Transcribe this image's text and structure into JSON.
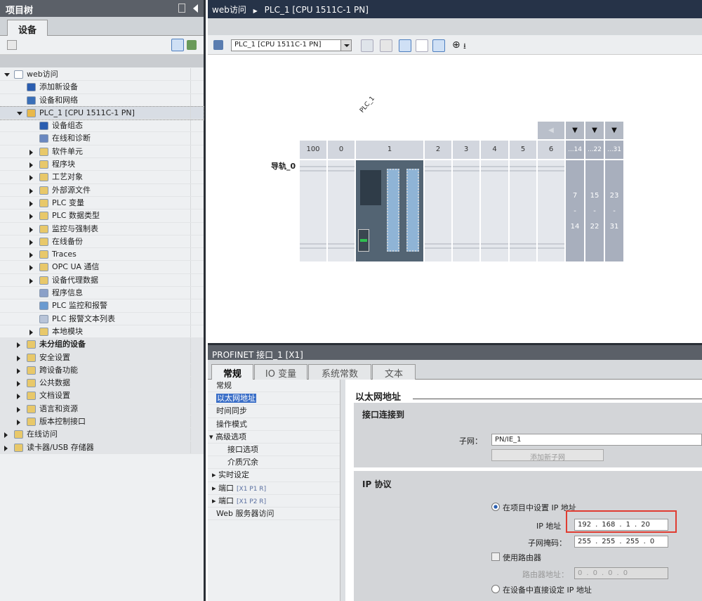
{
  "left_panel": {
    "title": "项目树",
    "tab": "设备",
    "tree": [
      {
        "label": "web访问",
        "level": 0,
        "expander": "open",
        "icon": "project-icon",
        "color": "#ffffff"
      },
      {
        "label": "添加新设备",
        "level": 1,
        "expander": "none",
        "icon": "add-device-icon",
        "color": "#2a5db0"
      },
      {
        "label": "设备和网络",
        "level": 1,
        "expander": "none",
        "icon": "network-icon",
        "color": "#3a6fb8"
      },
      {
        "label": "PLC_1 [CPU 1511C-1 PN]",
        "level": 1,
        "expander": "open",
        "icon": "plc-icon",
        "color": "#e8b84a",
        "selected": true
      },
      {
        "label": "设备组态",
        "level": 2,
        "expander": "none",
        "icon": "device-config-icon",
        "color": "#2a5db0"
      },
      {
        "label": "在线和诊断",
        "level": 2,
        "expander": "none",
        "icon": "diagnostics-icon",
        "color": "#6a88c0"
      },
      {
        "label": "软件单元",
        "level": 2,
        "expander": "closed",
        "icon": "folder-icon",
        "color": "#e8c86a"
      },
      {
        "label": "程序块",
        "level": 2,
        "expander": "closed",
        "icon": "folder-icon",
        "color": "#e8c86a"
      },
      {
        "label": "工艺对象",
        "level": 2,
        "expander": "closed",
        "icon": "folder-icon",
        "color": "#e8c86a"
      },
      {
        "label": "外部源文件",
        "level": 2,
        "expander": "closed",
        "icon": "folder-icon",
        "color": "#e8c86a"
      },
      {
        "label": "PLC 变量",
        "level": 2,
        "expander": "closed",
        "icon": "folder-icon",
        "color": "#e8c86a"
      },
      {
        "label": "PLC 数据类型",
        "level": 2,
        "expander": "closed",
        "icon": "folder-icon",
        "color": "#e8c86a"
      },
      {
        "label": "监控与强制表",
        "level": 2,
        "expander": "closed",
        "icon": "folder-icon",
        "color": "#e8c86a"
      },
      {
        "label": "在线备份",
        "level": 2,
        "expander": "closed",
        "icon": "folder-icon",
        "color": "#e8c86a"
      },
      {
        "label": "Traces",
        "level": 2,
        "expander": "closed",
        "icon": "folder-icon",
        "color": "#e8c86a"
      },
      {
        "label": "OPC UA 通信",
        "level": 2,
        "expander": "closed",
        "icon": "folder-icon",
        "color": "#e8c86a"
      },
      {
        "label": "设备代理数据",
        "level": 2,
        "expander": "closed",
        "icon": "folder-icon",
        "color": "#e8c86a"
      },
      {
        "label": "程序信息",
        "level": 2,
        "expander": "none",
        "icon": "program-info-icon",
        "color": "#8aa0c8"
      },
      {
        "label": "PLC 监控和报警",
        "level": 2,
        "expander": "none",
        "icon": "alarm-icon",
        "color": "#6a9ad0"
      },
      {
        "label": "PLC 报警文本列表",
        "level": 2,
        "expander": "none",
        "icon": "text-list-icon",
        "color": "#b8c4d8"
      },
      {
        "label": "本地模块",
        "level": 2,
        "expander": "closed",
        "icon": "folder-icon",
        "color": "#e8c86a"
      },
      {
        "label": "未分组的设备",
        "level": 1,
        "expander": "closed",
        "icon": "folder-icon",
        "color": "#e8c86a",
        "bold": true
      },
      {
        "label": "安全设置",
        "level": 1,
        "expander": "closed",
        "icon": "folder-icon",
        "color": "#e8c86a"
      },
      {
        "label": "跨设备功能",
        "level": 1,
        "expander": "closed",
        "icon": "folder-icon",
        "color": "#e8c86a"
      },
      {
        "label": "公共数据",
        "level": 1,
        "expander": "closed",
        "icon": "folder-icon",
        "color": "#e8c86a"
      },
      {
        "label": "文档设置",
        "level": 1,
        "expander": "closed",
        "icon": "folder-icon",
        "color": "#e8c86a"
      },
      {
        "label": "语言和资源",
        "level": 1,
        "expander": "closed",
        "icon": "folder-icon",
        "color": "#e8c86a"
      },
      {
        "label": "版本控制接口",
        "level": 1,
        "expander": "closed",
        "icon": "folder-icon",
        "color": "#e8c86a"
      },
      {
        "label": "在线访问",
        "level": 0,
        "expander": "closed",
        "icon": "folder-icon",
        "color": "#e8c86a"
      },
      {
        "label": "读卡器/USB 存储器",
        "level": 0,
        "expander": "closed",
        "icon": "folder-icon",
        "color": "#e8c86a"
      }
    ]
  },
  "editor": {
    "breadcrumb": [
      "web访问",
      "PLC_1 [CPU 1511C-1 PN]"
    ],
    "device_select": "PLC_1 [CPU 1511C-1 PN]",
    "device_label": "PLC_1",
    "rail_label": "导轨_0",
    "slots": [
      "100",
      "0",
      "1",
      "2",
      "3",
      "4",
      "5",
      "6"
    ],
    "expansion": [
      {
        "head": "...14",
        "from": "7",
        "to": "14"
      },
      {
        "head": "...22",
        "from": "15",
        "to": "22"
      },
      {
        "head": "...31",
        "from": "23",
        "to": "31"
      }
    ],
    "dash": "-"
  },
  "inspector": {
    "title": "PROFINET 接口_1 [X1]",
    "tabs": [
      "常规",
      "IO 变量",
      "系统常数",
      "文本"
    ],
    "nav": [
      {
        "label": "常规",
        "level": 0
      },
      {
        "label": "以太网地址",
        "level": 0,
        "selected": true
      },
      {
        "label": "时间同步",
        "level": 0
      },
      {
        "label": "操作模式",
        "level": 0
      },
      {
        "label": "高级选项",
        "level": 0,
        "expander": "open"
      },
      {
        "label": "接口选项",
        "level": 2
      },
      {
        "label": "介质冗余",
        "level": 2
      },
      {
        "label": "实时设定",
        "level": 1,
        "expander": "closed"
      },
      {
        "label": "端口",
        "suffix": "[X1 P1 R]",
        "level": 1,
        "expander": "closed"
      },
      {
        "label": "端口",
        "suffix": "[X1 P2 R]",
        "level": 1,
        "expander": "closed"
      },
      {
        "label": "Web 服务器访问",
        "level": 0
      }
    ],
    "section_title": "以太网地址",
    "connect": {
      "title": "接口连接到",
      "subnet_label": "子网：",
      "subnet_value": "PN/IE_1",
      "add_subnet": "添加新子网"
    },
    "ip": {
      "title": "IP 协议",
      "opt_project": "在项目中设置 IP 地址",
      "ip_label": "IP 地址",
      "ip": [
        "192",
        "168",
        "1",
        "20"
      ],
      "mask_label": "子网掩码：",
      "mask": [
        "255",
        "255",
        "255",
        "0"
      ],
      "router_check": "使用路由器",
      "router_label": "路由器地址：",
      "router": [
        "0",
        "0",
        "0",
        "0"
      ],
      "opt_device": "在设备中直接设定 IP 地址",
      "highlight_color": "#e03c31"
    }
  }
}
